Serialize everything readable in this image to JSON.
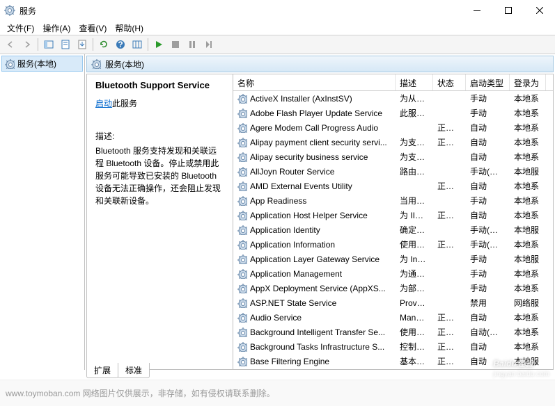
{
  "window": {
    "title": "服务"
  },
  "menu": {
    "file": "文件(F)",
    "action": "操作(A)",
    "view": "查看(V)",
    "help": "帮助(H)"
  },
  "tree": {
    "root": "服务(本地)"
  },
  "panel_header": "服务(本地)",
  "detail": {
    "title": "Bluetooth Support Service",
    "start_link": "启动",
    "start_suffix": "此服务",
    "desc_label": "描述:",
    "desc_text": "Bluetooth 服务支持发现和关联远程 Bluetooth 设备。停止或禁用此服务可能导致已安装的 Bluetooth 设备无法正确操作，还会阻止发现和关联新设备。"
  },
  "columns": {
    "name": "名称",
    "desc": "描述",
    "status": "状态",
    "startup": "启动类型",
    "logon": "登录为"
  },
  "rows": [
    {
      "name": "ActiveX Installer (AxInstSV)",
      "desc": "为从…",
      "status": "",
      "startup": "手动",
      "logon": "本地系"
    },
    {
      "name": "Adobe Flash Player Update Service",
      "desc": "此服…",
      "status": "",
      "startup": "手动",
      "logon": "本地系"
    },
    {
      "name": "Agere Modem Call Progress Audio",
      "desc": "",
      "status": "正在…",
      "startup": "自动",
      "logon": "本地系"
    },
    {
      "name": "Alipay payment client security servi...",
      "desc": "为支…",
      "status": "正在…",
      "startup": "自动",
      "logon": "本地系"
    },
    {
      "name": "Alipay security business service",
      "desc": "为支…",
      "status": "",
      "startup": "自动",
      "logon": "本地系"
    },
    {
      "name": "AllJoyn Router Service",
      "desc": "路由…",
      "status": "",
      "startup": "手动(触发…",
      "logon": "本地服"
    },
    {
      "name": "AMD External Events Utility",
      "desc": "",
      "status": "正在…",
      "startup": "自动",
      "logon": "本地系"
    },
    {
      "name": "App Readiness",
      "desc": "当用…",
      "status": "",
      "startup": "手动",
      "logon": "本地系"
    },
    {
      "name": "Application Host Helper Service",
      "desc": "为 II…",
      "status": "正在…",
      "startup": "自动",
      "logon": "本地系"
    },
    {
      "name": "Application Identity",
      "desc": "确定…",
      "status": "",
      "startup": "手动(触发…",
      "logon": "本地服"
    },
    {
      "name": "Application Information",
      "desc": "使用…",
      "status": "正在…",
      "startup": "手动(触发…",
      "logon": "本地系"
    },
    {
      "name": "Application Layer Gateway Service",
      "desc": "为 In…",
      "status": "",
      "startup": "手动",
      "logon": "本地服"
    },
    {
      "name": "Application Management",
      "desc": "为通…",
      "status": "",
      "startup": "手动",
      "logon": "本地系"
    },
    {
      "name": "AppX Deployment Service (AppXS...",
      "desc": "为部…",
      "status": "",
      "startup": "手动",
      "logon": "本地系"
    },
    {
      "name": "ASP.NET State Service",
      "desc": "Prov…",
      "status": "",
      "startup": "禁用",
      "logon": "网络服"
    },
    {
      "name": "Audio Service",
      "desc": "Man…",
      "status": "正在…",
      "startup": "自动",
      "logon": "本地系"
    },
    {
      "name": "Background Intelligent Transfer Se...",
      "desc": "使用…",
      "status": "正在…",
      "startup": "自动(延迟…",
      "logon": "本地系"
    },
    {
      "name": "Background Tasks Infrastructure S...",
      "desc": "控制…",
      "status": "正在…",
      "startup": "自动",
      "logon": "本地系"
    },
    {
      "name": "Base Filtering Engine",
      "desc": "基本…",
      "status": "正在…",
      "startup": "自动",
      "logon": "本地服"
    }
  ],
  "tabs": {
    "ext": "扩展",
    "std": "标准"
  },
  "footer": "www.toymoban.com  网络图片仅供展示，非存储，如有侵权请联系删除。",
  "watermark": {
    "main": "Baidu经验",
    "sub": "jingyan.baidu.com"
  }
}
